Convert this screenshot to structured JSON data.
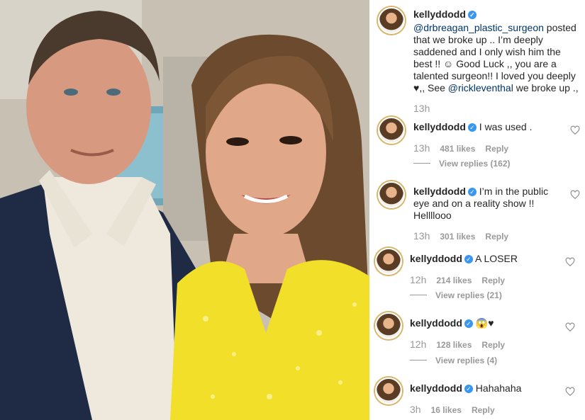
{
  "post": {
    "username": "kellyddodd",
    "caption_parts": [
      {
        "type": "mention",
        "text": "@drbreagan_plastic_surgeon"
      },
      {
        "type": "text",
        "text": " posted that we broke up .. I’m deeply saddened and I only wish him the best !! ☺ Good Luck ,, you are a talented surgeon!! I loved you deeply ♥,, See "
      },
      {
        "type": "mention",
        "text": "@rickleventhal"
      },
      {
        "type": "text",
        "text": " we broke up .,"
      }
    ],
    "time": "13h"
  },
  "comments": [
    {
      "username": "kellyddodd",
      "text": "I was used .",
      "time": "13h",
      "likes": "481 likes",
      "reply": "Reply",
      "view_replies": "View replies (162)"
    },
    {
      "username": "kellyddodd",
      "text": "I’m in the public eye and on a reality show !! Hellllooo",
      "time": "13h",
      "likes": "301 likes",
      "reply": "Reply",
      "view_replies": ""
    },
    {
      "username": "kellyddodd",
      "text": "A LOSER",
      "time": "12h",
      "likes": "214 likes",
      "reply": "Reply",
      "view_replies": "View replies (21)"
    },
    {
      "username": "kellyddodd",
      "text": "😱♥",
      "time": "12h",
      "likes": "128 likes",
      "reply": "Reply",
      "view_replies": "View replies (4)"
    },
    {
      "username": "kellyddodd",
      "text": "Hahahaha",
      "time": "3h",
      "likes": "16 likes",
      "reply": "Reply",
      "view_replies": ""
    }
  ],
  "icons": {
    "verified": "verified-badge-icon",
    "like": "heart-outline-icon"
  },
  "colors": {
    "mention": "#003569",
    "verified": "#3897f0",
    "meta": "#999999",
    "dress": "#f2df2a",
    "jacket": "#1f2a44"
  }
}
